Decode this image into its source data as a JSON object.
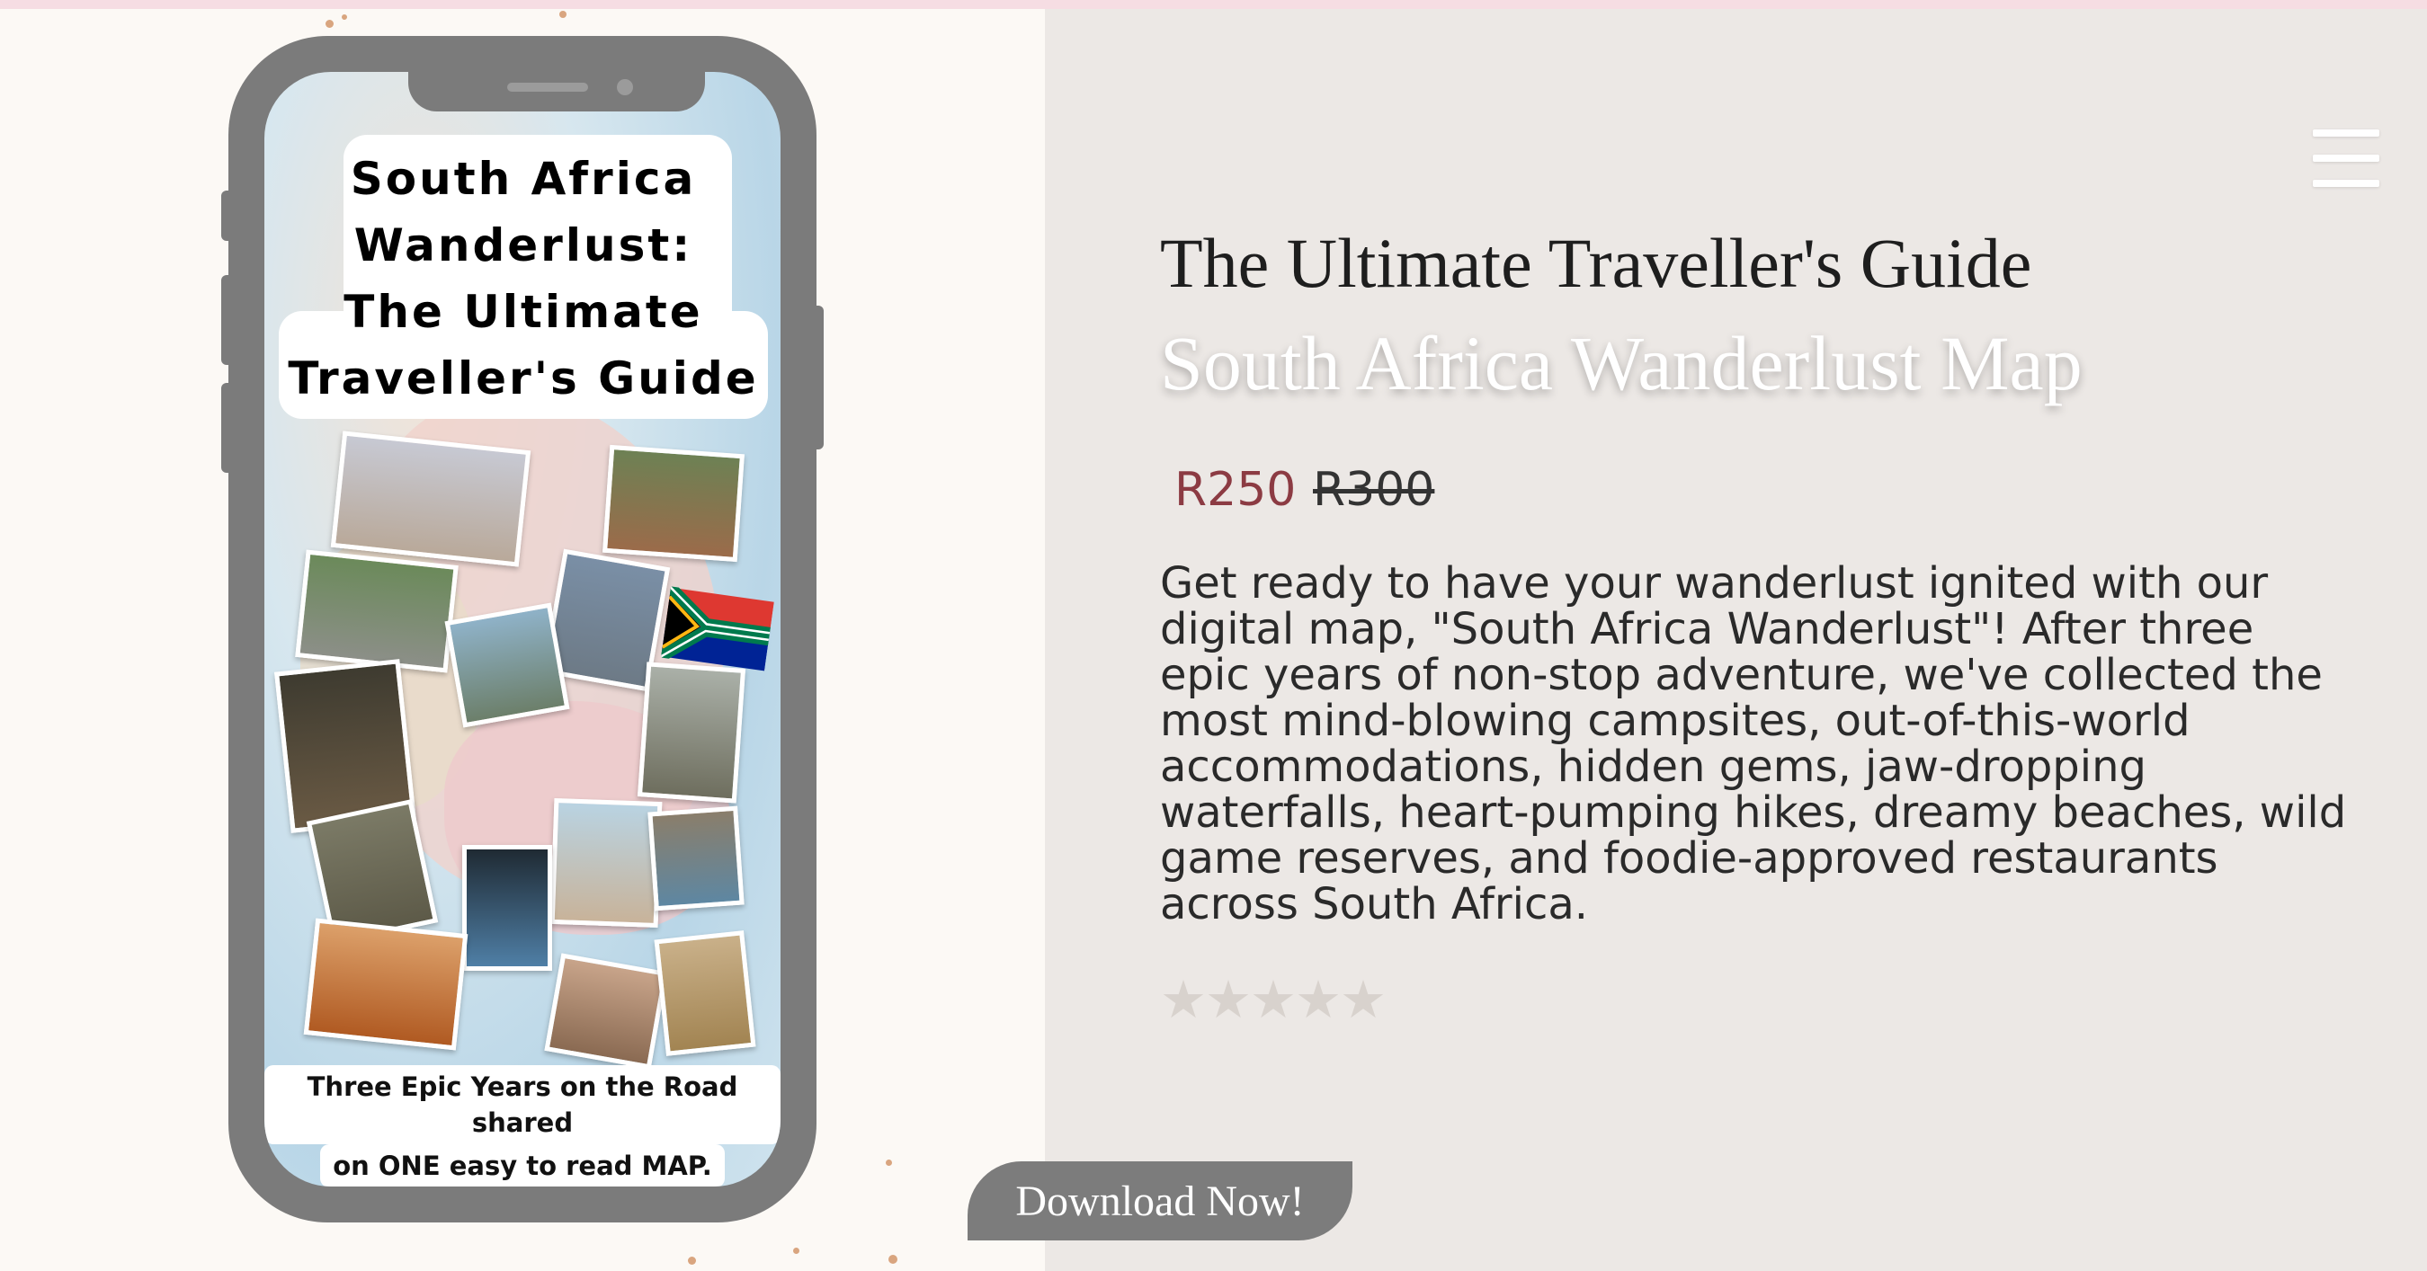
{
  "phone": {
    "cover_title": "South Africa\nWanderlust:\nThe Ultimate\nTraveller's Guide",
    "caption_line1": "Three Epic Years on the Road shared",
    "caption_line2": "on ONE easy to read MAP."
  },
  "product": {
    "subtitle": "The Ultimate Traveller's Guide",
    "title": "South Africa Wanderlust Map",
    "price_current": "R250",
    "price_original": "R300",
    "description": "Get ready to have your wanderlust ignited with our digital map, \"South Africa Wanderlust\"! After three epic years of non-stop adventure, we've collected the most mind-blowing campsites, out-of-this-world accommodations, hidden gems, jaw-dropping waterfalls, heart-pumping hikes, dreamy beaches, wild game reserves, and foodie-approved restaurants across South Africa.",
    "rating_stars": "★★★★★",
    "cta_label": "Download Now!"
  },
  "nav": {
    "menu_icon": "hamburger-menu-icon"
  },
  "colors": {
    "left_bg": "#fcf9f5",
    "right_bg": "#ece8e5",
    "phone_frame": "#7b7b7b",
    "price_accent": "#8c3b43",
    "button_bg": "#7c7c7c"
  }
}
